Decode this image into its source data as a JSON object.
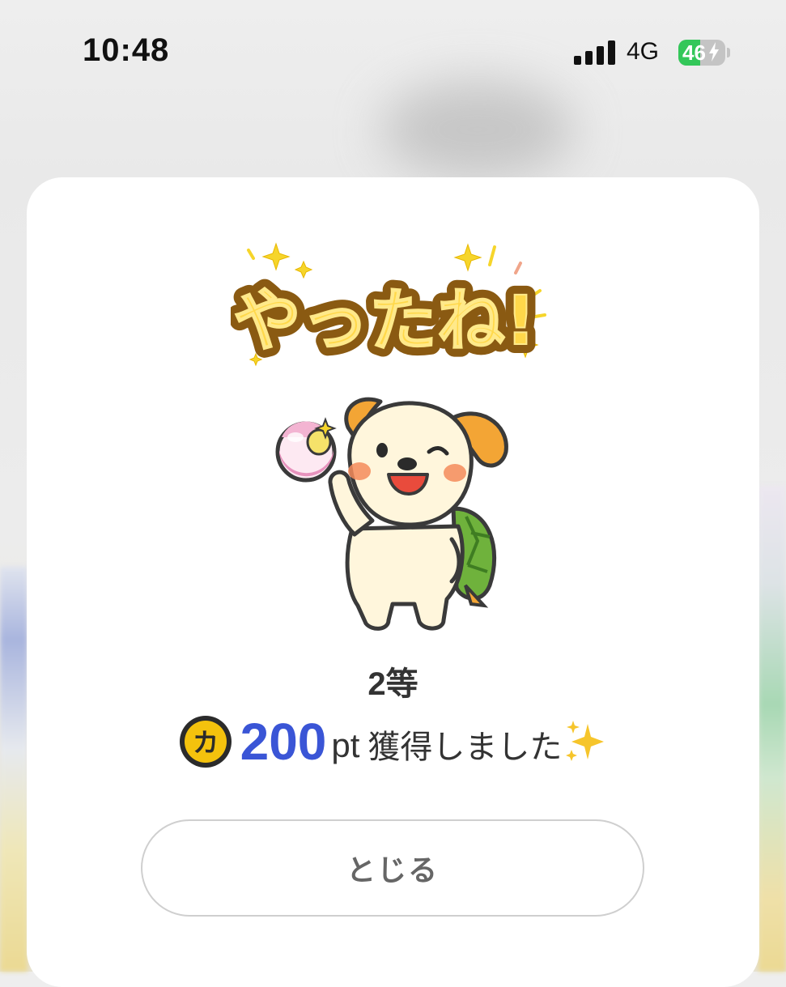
{
  "status_bar": {
    "time": "10:48",
    "network": "4G",
    "battery_level": "46",
    "battery_fraction": 0.46
  },
  "modal": {
    "banner_text": "やったね!",
    "rank": "2等",
    "coin_symbol": "カ",
    "points": "200",
    "points_unit": "pt",
    "message": "獲得しました",
    "close_label": "とじる"
  },
  "colors": {
    "points_blue": "#3a55d6",
    "coin_yellow": "#f4c20d",
    "banner_yellow": "#ffd84a",
    "banner_outline": "#8a5a12",
    "battery_green": "#33c759"
  },
  "icons": [
    "signal-bars-icon",
    "battery-icon",
    "coin-icon",
    "sparkles-icon",
    "mascot-illustration"
  ]
}
